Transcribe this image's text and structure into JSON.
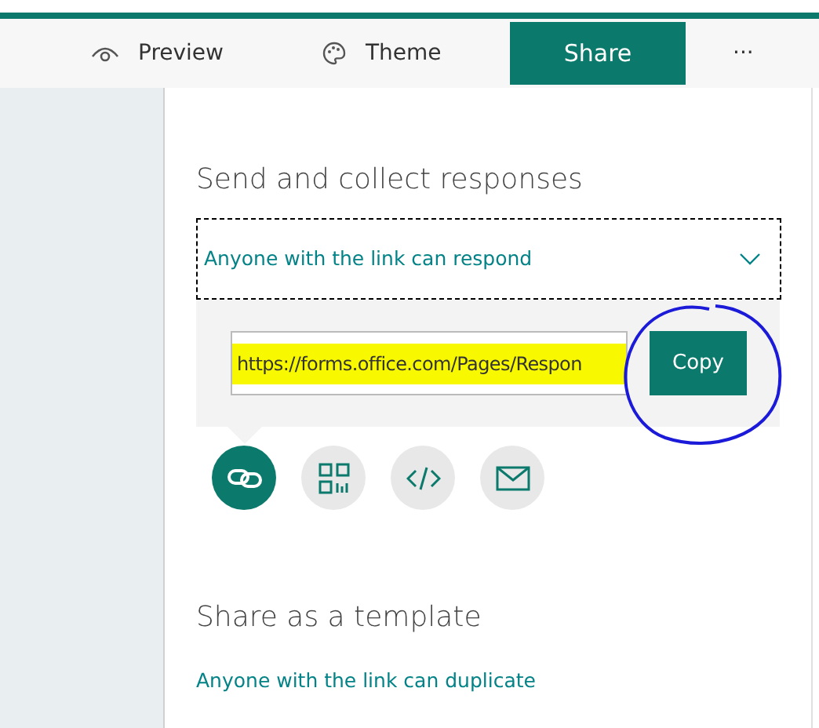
{
  "toolbar": [
    {
      "kind": "preview",
      "label": "Preview",
      "selected": false
    },
    {
      "kind": "theme",
      "label": "Theme",
      "selected": false
    },
    {
      "kind": "share",
      "label": "Share",
      "selected": true
    },
    {
      "kind": "more",
      "label": "···",
      "selected": false
    }
  ],
  "send_section": {
    "title": "Send and collect responses",
    "permission": "Anyone with the link can respond",
    "link": "https://forms.office.com/Pages/Respon",
    "copy_button": "Copy"
  },
  "share_options": [
    {
      "kind": "link",
      "selected": true
    },
    {
      "kind": "qr",
      "selected": false
    },
    {
      "kind": "embed",
      "selected": false
    },
    {
      "kind": "email",
      "selected": false
    }
  ],
  "template_section": {
    "title": "Share as a template",
    "permission": "Anyone with the link can duplicate"
  }
}
